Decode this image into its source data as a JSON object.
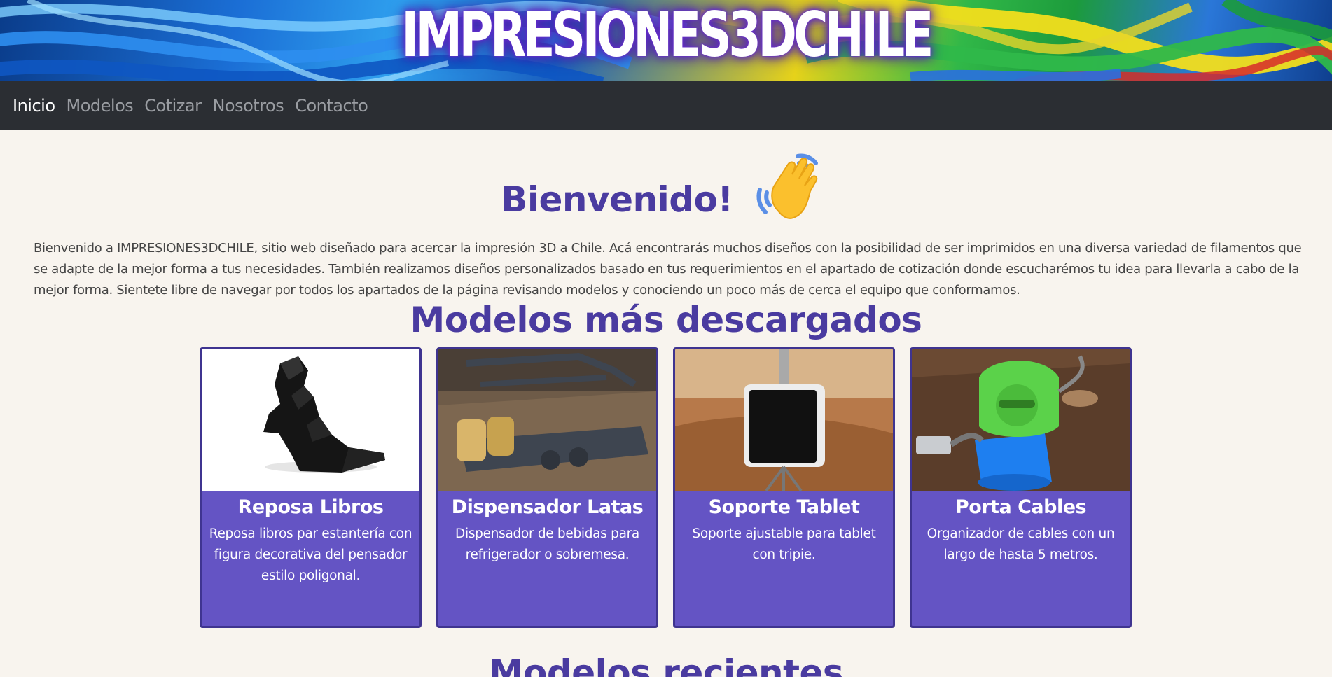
{
  "header": {
    "brand": "IMPRESIONES3DCHILE"
  },
  "nav": {
    "items": [
      {
        "label": "Inicio",
        "active": true
      },
      {
        "label": "Modelos",
        "active": false
      },
      {
        "label": "Cotizar",
        "active": false
      },
      {
        "label": "Nosotros",
        "active": false
      },
      {
        "label": "Contacto",
        "active": false
      }
    ]
  },
  "welcome": {
    "title": "Bienvenido!",
    "icon": "waving-hand-icon",
    "text": "Bienvenido a IMPRESIONES3DCHILE, sitio web diseñado para acercar la impresión 3D a Chile. Acá encontrarás muchos diseños con la posibilidad de ser imprimidos en una diversa variedad de filamentos que se adapte de la mejor forma a tus necesidades. También realizamos diseños personalizados basado en tus requerimientos en el apartado de cotización donde escucharémos tu idea para llevarla a cabo de la mejor forma. Sientete libre de navegar por todos los apartados de la página revisando modelos y conociendo un poco más de cerca el equipo que conformamos."
  },
  "most_downloaded": {
    "title": "Modelos más descargados",
    "cards": [
      {
        "title": "Reposa Libros",
        "description": "Reposa libros par estantería con figura decorativa del pensador estilo poligonal."
      },
      {
        "title": "Dispensador Latas",
        "description": "Dispensador de bebidas para refrigerador o sobremesa."
      },
      {
        "title": "Soporte Tablet",
        "description": "Soporte ajustable para tablet con tripie."
      },
      {
        "title": "Porta Cables",
        "description": "Organizador de cables con un largo de hasta 5 metros."
      }
    ]
  },
  "recent": {
    "title": "Modelos recientes"
  },
  "colors": {
    "accent": "#4a3ba0",
    "card_bg": "#6454c4",
    "navbar_bg": "#2b2e33",
    "page_bg": "#f8f4ee"
  }
}
